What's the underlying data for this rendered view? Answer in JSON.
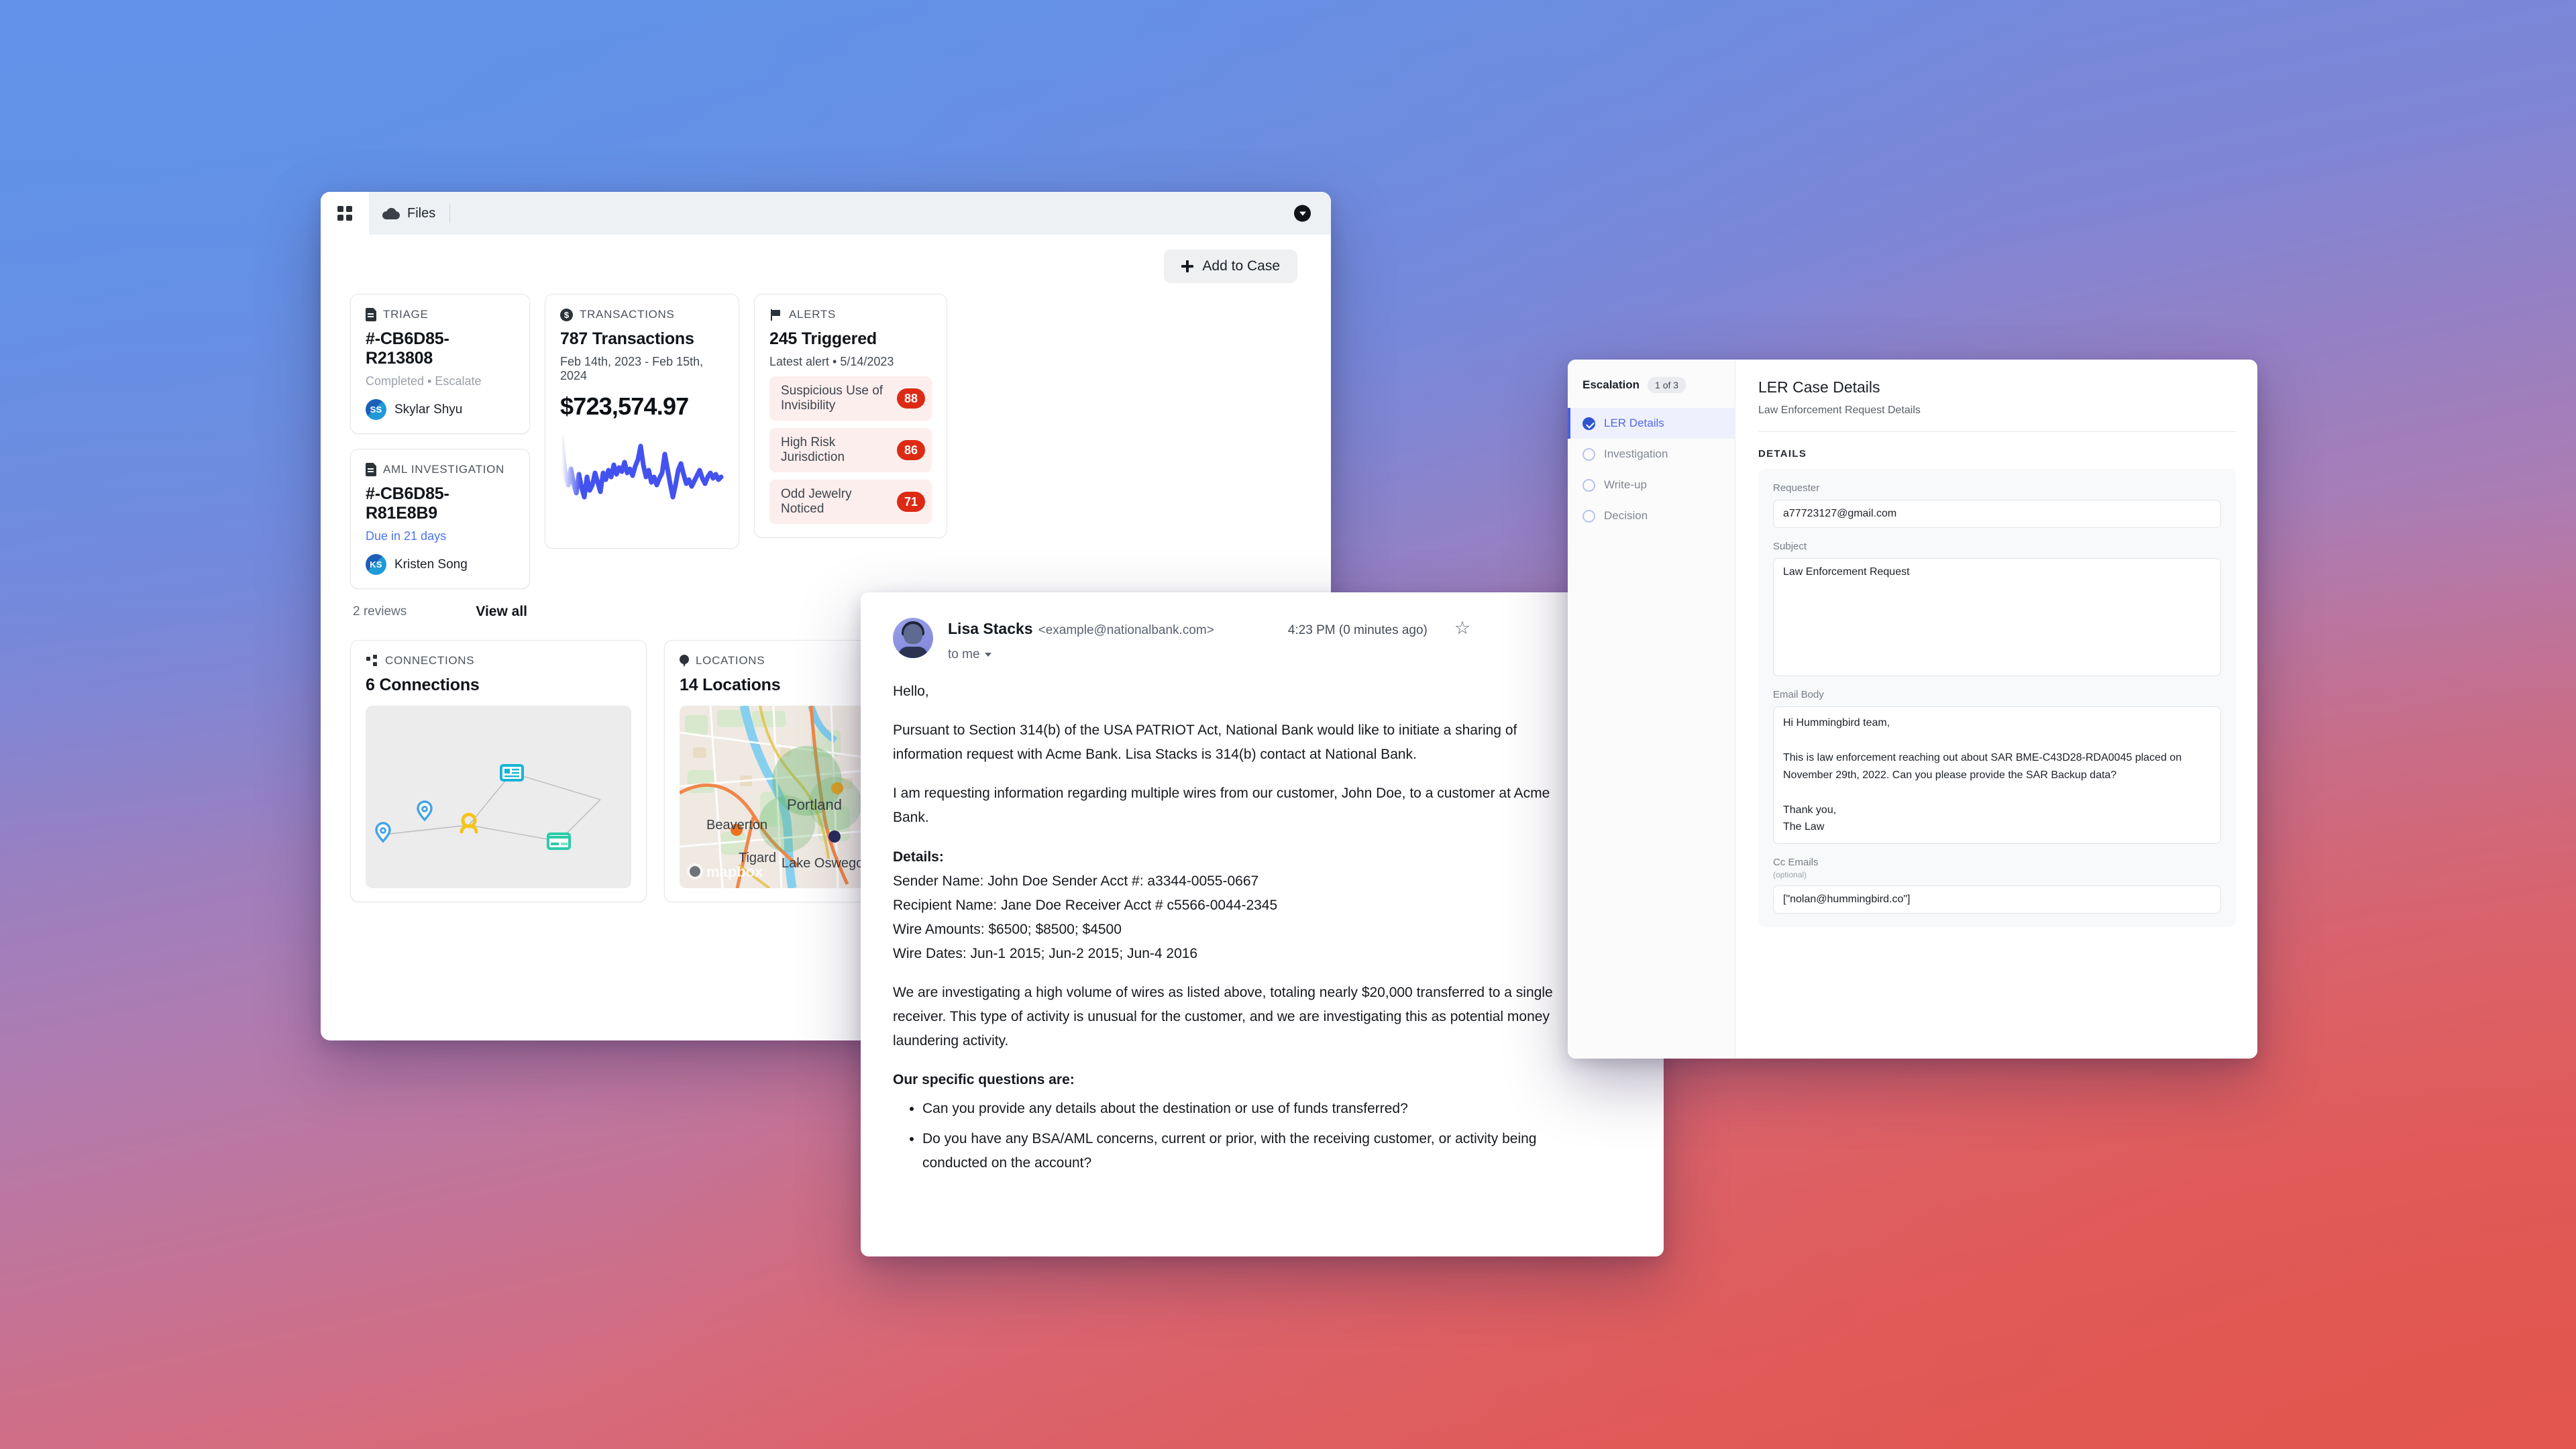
{
  "case_window": {
    "tabs": [
      {
        "label": "",
        "icon": "grid-icon"
      },
      {
        "label": "Files",
        "icon": "cloud-icon"
      }
    ],
    "collapse_icon": "chevron-down-circle-icon",
    "add_to_case_label": "Add to Case",
    "triage": {
      "header": "TRIAGE",
      "icon": "document-icon",
      "case_id": "#-CB6D85-R213808",
      "status": "Completed ▪ Escalate",
      "assignee": "Skylar Shyu",
      "assignee_initials": "SS"
    },
    "aml": {
      "header": "AML INVESTIGATION",
      "icon": "document-icon",
      "case_id": "#-CB6D85-R81E8B9",
      "status": "Due in 21 days",
      "assignee": "Kristen Song",
      "assignee_initials": "KS"
    },
    "reviews": {
      "count_label": "2 reviews",
      "view_all_label": "View all"
    },
    "transactions": {
      "header": "TRANSACTIONS",
      "icon": "dollar-circle-icon",
      "count": "787 Transactions",
      "date_range": "Feb 14th, 2023 - Feb 15th, 2024",
      "amount": "$723,574.97"
    },
    "alerts": {
      "header": "ALERTS",
      "icon": "flag-icon",
      "count": "245 Triggered",
      "latest": "Latest alert  •  5/14/2023",
      "items": [
        {
          "name": "Suspicious Use of Invisibility",
          "score": "88"
        },
        {
          "name": "High Risk Jurisdiction",
          "score": "86"
        },
        {
          "name": "Odd Jewelry Noticed",
          "score": "71"
        }
      ],
      "score_color": "#dc2a14"
    },
    "connections": {
      "header": "CONNECTIONS",
      "icon": "connections-icon",
      "count": "6 Connections"
    },
    "locations": {
      "header": "LOCATIONS",
      "icon": "map-pin-icon",
      "count": "14 Locations",
      "map_labels": [
        "Portland",
        "Beaverton",
        "Tigard",
        "Lake Oswego"
      ],
      "attribution": "mapbox"
    }
  },
  "email_window": {
    "sender": "Lisa Stacks",
    "sender_email": "<example@nationalbank.com>",
    "time": "4:23 PM (0 minutes ago)",
    "star_icon": "star-icon",
    "recipients": "to me",
    "greeting": "Hello,",
    "para1": "Pursuant to Section 314(b) of the USA PATRIOT Act, National Bank would like to initiate a sharing of information request with Acme Bank. Lisa Stacks is 314(b) contact at National Bank.",
    "para2": "I am requesting information regarding multiple wires from our customer, John Doe, to a customer at Acme Bank.",
    "details_heading": "Details:",
    "details": [
      "Sender Name: John Doe Sender Acct #: a3344-0055-0667",
      "Recipient Name: Jane Doe Receiver Acct # c5566-0044-2345",
      "Wire Amounts: $6500; $8500; $4500",
      "Wire Dates: Jun-1 2015; Jun-2 2015; Jun-4 2016"
    ],
    "para3": "We are investigating a high volume of wires as listed above, totaling nearly $20,000 transferred to a single receiver. This type of activity is unusual for the customer, and we are investigating this as potential money laundering activity.",
    "questions_heading": "Our specific questions are:",
    "questions": [
      "Can you provide any details about the destination or use of funds transferred?",
      "Do you have any BSA/AML concerns, current or prior, with the receiving customer, or activity being conducted on the account?"
    ]
  },
  "ler_window": {
    "sidebar": {
      "title": "Escalation",
      "chip": "1 of 3",
      "steps": [
        {
          "label": "LER Details",
          "active": true
        },
        {
          "label": "Investigation",
          "active": false
        },
        {
          "label": "Write-up",
          "active": false
        },
        {
          "label": "Decision",
          "active": false
        }
      ]
    },
    "title": "LER Case Details",
    "subtitle": "Law Enforcement Request Details",
    "section_label": "DETAILS",
    "fields": {
      "requester_label": "Requester",
      "requester_value": "a77723127@gmail.com",
      "subject_label": "Subject",
      "subject_value": "Law Enforcement Request",
      "email_body_label": "Email Body",
      "email_body_value": "Hi Hummingbird team,\n\nThis is law enforcement reaching out about SAR BME-C43D28-RDA0045 placed on November 29th, 2022. Can you please provide the SAR Backup data?\n\nThank you,\nThe Law",
      "cc_label": "Cc Emails",
      "cc_optional": "(optional)",
      "cc_value": "[\"nolan@hummingbird.co\"]"
    }
  }
}
